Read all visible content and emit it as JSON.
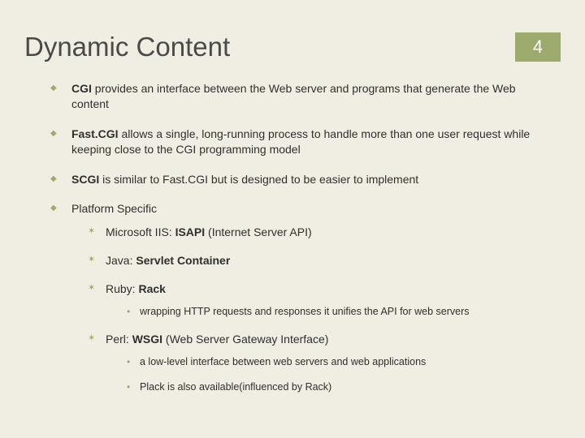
{
  "title": "Dynamic Content",
  "page_number": "4",
  "bullets": [
    {
      "lead_bold": "CGI",
      "rest": " provides an interface between the Web server and programs that generate the Web content"
    },
    {
      "lead_bold": "Fast.CGI",
      "rest": " allows a single, long-running process to handle more than one user request while keeping close to the CGI programming model"
    },
    {
      "lead_bold": "SCGI",
      "rest": " is similar to Fast.CGI but is designed to be easier to implement"
    },
    {
      "lead_bold": "",
      "rest": "Platform Specific"
    }
  ],
  "platform": [
    {
      "pre": "Microsoft IIS: ",
      "bold": "ISAPI",
      "post": " (Internet Server API)"
    },
    {
      "pre": "Java: ",
      "bold": "Servlet Container",
      "post": ""
    },
    {
      "pre": "Ruby: ",
      "bold": "Rack",
      "post": ""
    },
    {
      "pre": "Perl: ",
      "bold": "WSGI",
      "post": " (Web Server Gateway Interface)"
    }
  ],
  "ruby_sub": [
    "wrapping HTTP requests and responses it unifies the API for web servers"
  ],
  "perl_sub": [
    "a low-level interface between web servers and web applications",
    "Plack is also available(influenced by Rack)"
  ]
}
